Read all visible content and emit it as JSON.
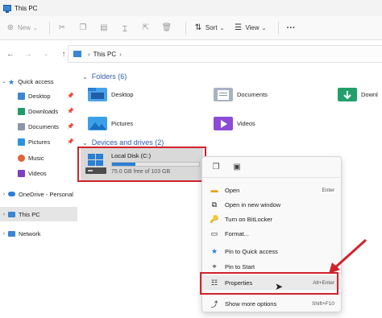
{
  "window": {
    "title": "This PC",
    "icon": "pc-icon"
  },
  "toolbar": {
    "new_label": "New",
    "sort_label": "Sort",
    "view_label": "View",
    "more_label": "···"
  },
  "address": {
    "path": "This PC"
  },
  "sidebar": {
    "items": [
      {
        "label": "Quick access",
        "icon": "star-icon"
      },
      {
        "label": "Desktop",
        "icon": "desktop-icon"
      },
      {
        "label": "Downloads",
        "icon": "downloads-icon"
      },
      {
        "label": "Documents",
        "icon": "documents-icon"
      },
      {
        "label": "Pictures",
        "icon": "pictures-icon"
      },
      {
        "label": "Music",
        "icon": "music-icon"
      },
      {
        "label": "Videos",
        "icon": "videos-icon"
      },
      {
        "label": "OneDrive - Personal",
        "icon": "onedrive-icon"
      },
      {
        "label": "This PC",
        "icon": "pc-icon"
      },
      {
        "label": "Network",
        "icon": "network-icon"
      }
    ]
  },
  "content": {
    "folders_header": "Folders (6)",
    "folders": [
      {
        "label": "Desktop",
        "icon": "desktop-folder-icon"
      },
      {
        "label": "Documents",
        "icon": "documents-folder-icon"
      },
      {
        "label": "Downl",
        "icon": "downloads-folder-icon"
      },
      {
        "label": "Pictures",
        "icon": "pictures-folder-icon"
      },
      {
        "label": "Videos",
        "icon": "videos-folder-icon"
      }
    ],
    "devices_header": "Devices and drives (2)",
    "drive": {
      "name": "Local Disk (C:)",
      "free_text": "75.0 GB free of 103 GB",
      "used_fraction": 0.27
    }
  },
  "context_menu": {
    "items": [
      {
        "label": "Open",
        "shortcut": "Enter",
        "icon": "open-folder-icon"
      },
      {
        "label": "Open in new window",
        "shortcut": "",
        "icon": "new-window-icon"
      },
      {
        "label": "Turn on BitLocker",
        "shortcut": "",
        "icon": "bitlocker-icon"
      },
      {
        "label": "Format...",
        "shortcut": "",
        "icon": "format-icon"
      },
      {
        "label": "Pin to Quick access",
        "shortcut": "",
        "icon": "pin-icon"
      },
      {
        "label": "Pin to Start",
        "shortcut": "",
        "icon": "pin-start-icon"
      },
      {
        "label": "Properties",
        "shortcut": "Alt+Enter",
        "icon": "properties-icon"
      },
      {
        "label": "Show more options",
        "shortcut": "Shift+F10",
        "icon": "more-options-icon"
      }
    ]
  },
  "colors": {
    "accent": "#2b7fd4",
    "highlight": "#d1232a",
    "header_blue": "#2f5ea8"
  }
}
